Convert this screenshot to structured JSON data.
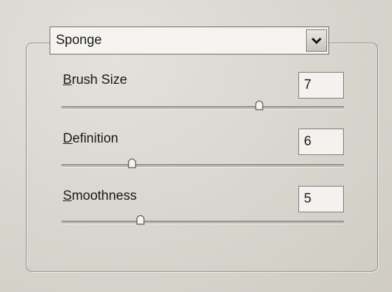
{
  "filter": {
    "selected": "Sponge"
  },
  "controls": [
    {
      "label_mnemonic": "B",
      "label_rest": "rush Size",
      "value": "7",
      "slider_fraction": 0.7
    },
    {
      "label_mnemonic": "D",
      "label_rest": "efinition",
      "value": "6",
      "slider_fraction": 0.25
    },
    {
      "label_mnemonic": "S",
      "label_rest": "moothness",
      "value": "5",
      "slider_fraction": 0.28
    }
  ],
  "icons": {
    "dropdown": "chevron-down-icon",
    "thumb": "slider-thumb"
  }
}
